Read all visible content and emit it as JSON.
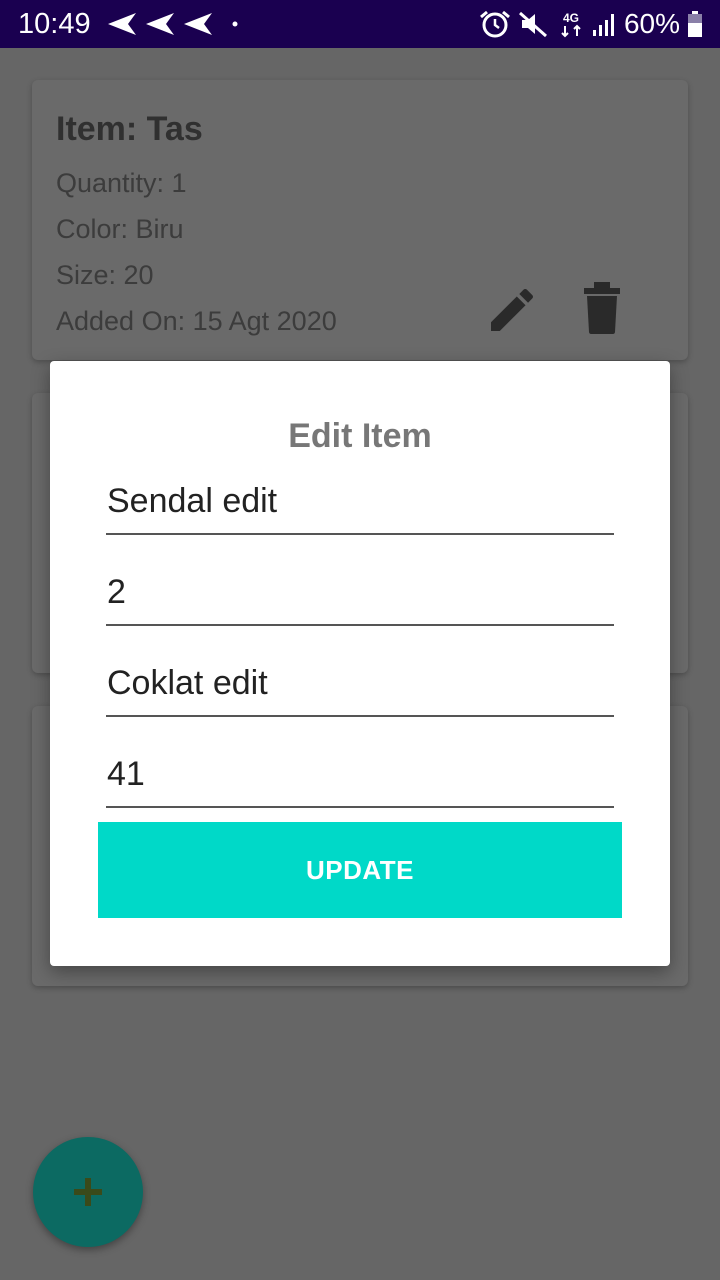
{
  "status_bar": {
    "time": "10:49",
    "network_type": "4G",
    "battery_percent": "60%",
    "icons": [
      "send-icon",
      "send-icon",
      "send-icon",
      "dot-icon",
      "alarm-icon",
      "mute-icon",
      "network-4g-icon",
      "signal-icon",
      "battery-icon"
    ]
  },
  "items": [
    {
      "title": "Item: Tas",
      "quantity": "Quantity: 1",
      "color": "Color: Biru",
      "size": "Size: 20",
      "added_on": "Added On: 15 Agt 2020"
    }
  ],
  "dialog": {
    "title": "Edit Item",
    "fields": [
      "Sendal edit",
      "2",
      "Coklat edit",
      "41"
    ],
    "update_label": "UPDATE"
  },
  "fab": {
    "icon": "plus-icon",
    "color": "#0c6a62"
  },
  "colors": {
    "status_bar": "#1a0050",
    "accent": "#00d9c8",
    "scrim": "#666666"
  }
}
